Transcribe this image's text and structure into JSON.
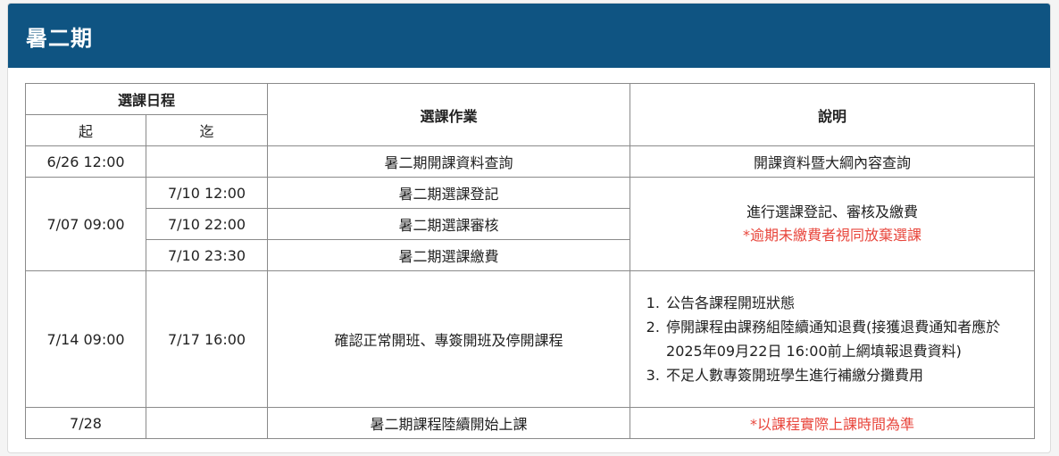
{
  "header": {
    "title": "暑二期"
  },
  "table": {
    "headers": {
      "schedule_group": "選課日程",
      "from": "起",
      "to": "迄",
      "operation": "選課作業",
      "description": "說明"
    },
    "rows": [
      {
        "from": "6/26 12:00",
        "to": "",
        "operation": "暑二期開課資料查詢",
        "description": "開課資料暨大綱內容查詢"
      },
      {
        "from": "7/07 09:00",
        "to": "7/10 12:00",
        "operation": "暑二期選課登記",
        "description": "進行選課登記、審核及繳費",
        "description_note": "*逾期未繳費者視同放棄選課"
      },
      {
        "to": "7/10 22:00",
        "operation": "暑二期選課審核"
      },
      {
        "to": "7/10 23:30",
        "operation": "暑二期選課繳費"
      },
      {
        "from": "7/14 09:00",
        "to": "7/17 16:00",
        "operation": "確認正常開班、專簽開班及停開課程",
        "description_items": [
          "公告各課程開班狀態",
          "停開課程由課務組陸續通知退費(接獲退費通知者應於2025年09月22日 16:00前上網填報退費資料)",
          "不足人數專簽開班學生進行補繳分攤費用"
        ]
      },
      {
        "from": "7/28",
        "to": "",
        "operation": "暑二期課程陸續開始上課",
        "description": "*以課程實際上課時間為準"
      }
    ]
  },
  "colors": {
    "header_bg": "#0f5482",
    "note_red": "#e8463c",
    "border": "#8a8a8a"
  }
}
